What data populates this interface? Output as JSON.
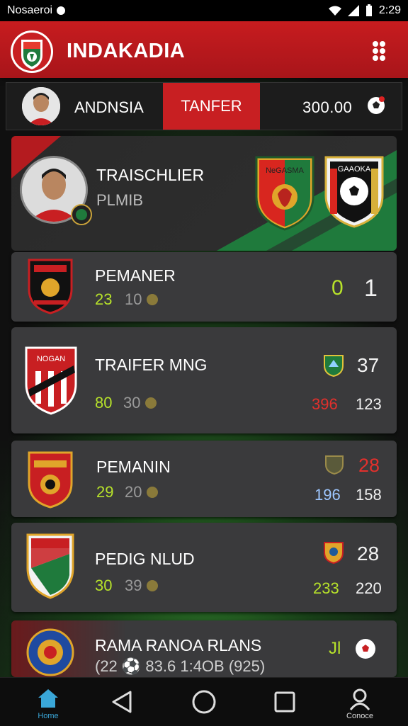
{
  "status": {
    "left_text": "Nosaeroi",
    "time": "2:29"
  },
  "app": {
    "title": "INDAKADIA"
  },
  "tabs": {
    "team": "ANDNSIA",
    "transfer": "TANFER",
    "value": "300.00"
  },
  "featured": {
    "name": "TRAISCHLIER",
    "subtitle": "PLMIB",
    "badge_text": "NeGASMA",
    "badge2_text": "GAAOKA"
  },
  "rows": [
    {
      "name": "PEMANER",
      "stat_a": "23",
      "stat_b": "10",
      "score_left": "0",
      "score_right": "1"
    },
    {
      "name": "TRAIFER MNG",
      "stat_a": "80",
      "stat_b": "30",
      "num_top": "37",
      "num_bottom_left": "396",
      "num_bottom_right": "123",
      "crest_text": "NOGAN"
    },
    {
      "name": "PEMANIN",
      "stat_a": "29",
      "stat_b": "20",
      "num_top": "28",
      "num_bottom_left": "196",
      "num_bottom_right": "158"
    },
    {
      "name": "PEDIG NLUD",
      "stat_a": "30",
      "stat_b": "39",
      "num_top": "28",
      "num_bottom_left": "233",
      "num_bottom_right": "220"
    },
    {
      "name": "RAMA RANOA RLANS",
      "stat_line": "(22 ⚽ 83.6 1:4ОВ (925)",
      "num_top": "Jl"
    }
  ],
  "nav": {
    "home": "Home",
    "account": "Conoce"
  },
  "colors": {
    "brand_red": "#c71c1f",
    "lime": "#b7e22a",
    "card": "#3a3a3c"
  }
}
